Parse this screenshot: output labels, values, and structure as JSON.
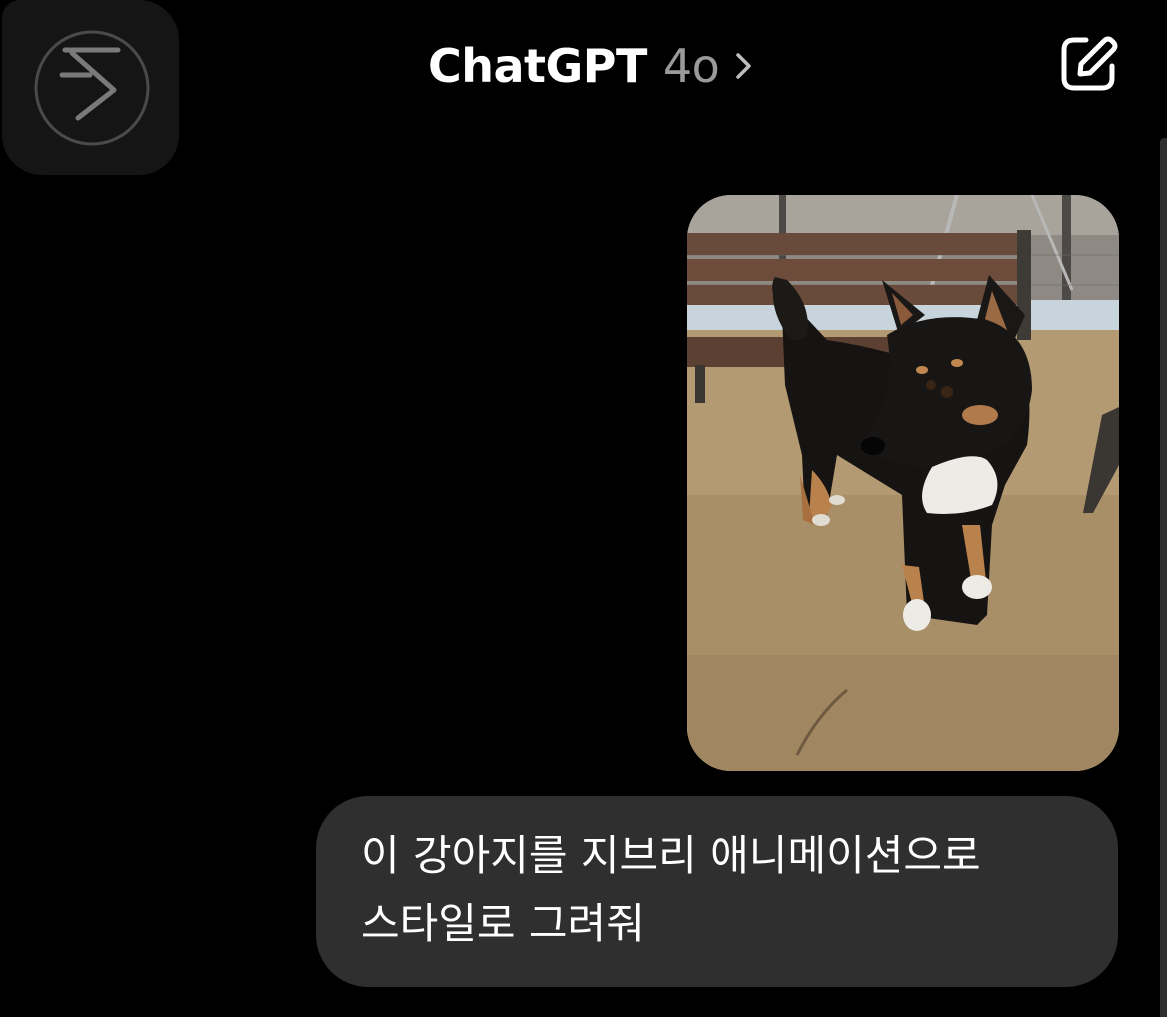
{
  "header": {
    "title": "ChatGPT",
    "model": "4o",
    "menu_icon": "sidebar-toggle-icon",
    "edit_icon": "new-chat-icon"
  },
  "conversation": {
    "messages": [
      {
        "role": "user",
        "attachment": {
          "type": "photo",
          "subject": "dog"
        },
        "text": "이 강아지를 지브리 애니메이션으로\n스타일로 그려줘"
      }
    ]
  },
  "colors": {
    "background": "#000000",
    "bubble": "#2f2f2f",
    "model_text": "#9a9a9a",
    "menu_tile": "#151515"
  }
}
